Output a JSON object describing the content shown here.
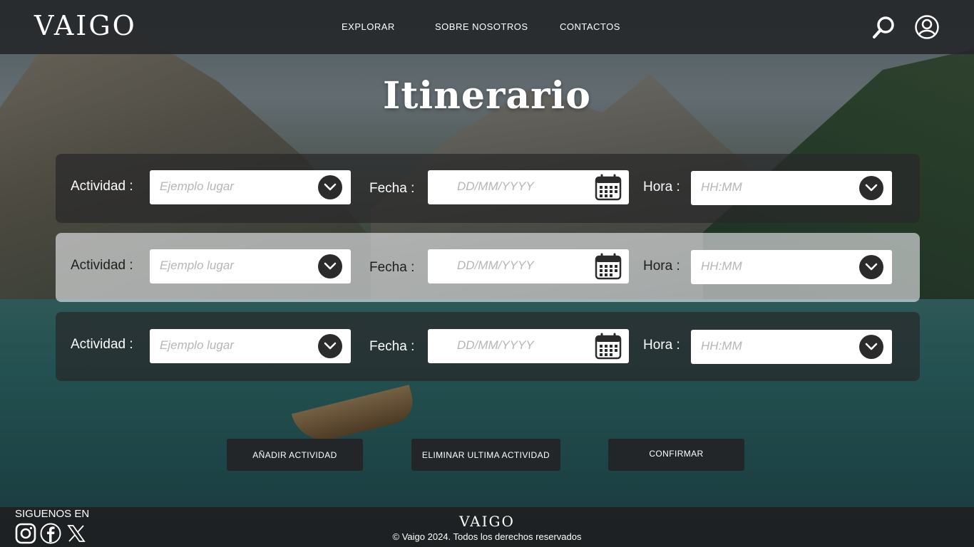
{
  "header": {
    "logo": "VAIGO",
    "nav": [
      "EXPLORAR",
      "SOBRE NOSOTROS",
      "CONTACTOS"
    ],
    "icons": [
      "search-icon",
      "user-icon"
    ]
  },
  "page": {
    "title": "Itinerario"
  },
  "rows": [
    {
      "actividad_label": "Actividad :",
      "actividad_placeholder": "Ejemplo lugar",
      "fecha_label": "Fecha :",
      "fecha_placeholder": "DD/MM/YYYY",
      "hora_label": "Hora :",
      "hora_placeholder": "HH:MM"
    },
    {
      "actividad_label": "Actividad :",
      "actividad_placeholder": "Ejemplo lugar",
      "fecha_label": "Fecha :",
      "fecha_placeholder": "DD/MM/YYYY",
      "hora_label": "Hora :",
      "hora_placeholder": "HH:MM"
    },
    {
      "actividad_label": "Actividad :",
      "actividad_placeholder": "Ejemplo lugar",
      "fecha_label": "Fecha :",
      "fecha_placeholder": "DD/MM/YYYY",
      "hora_label": "Hora :",
      "hora_placeholder": "HH:MM"
    }
  ],
  "actions": {
    "add": "AÑADIR ACTIVIDAD",
    "remove": "ELIMINAR ULTIMA ACTIVIDAD",
    "confirm": "CONFIRMAR"
  },
  "footer": {
    "follow_label": "SIGUENOS EN",
    "social": [
      "instagram-icon",
      "facebook-icon",
      "x-icon"
    ],
    "logo": "VAIGO",
    "copyright": "© Vaigo 2024. Todos los derechos reservados"
  },
  "colors": {
    "header_bg": "#232528",
    "row_dark": "#28282a",
    "row_light": "#ebeef0",
    "button_bg": "#242426",
    "dropdown_icon_bg": "#2b2b2b",
    "placeholder": "#b6b6b6"
  }
}
